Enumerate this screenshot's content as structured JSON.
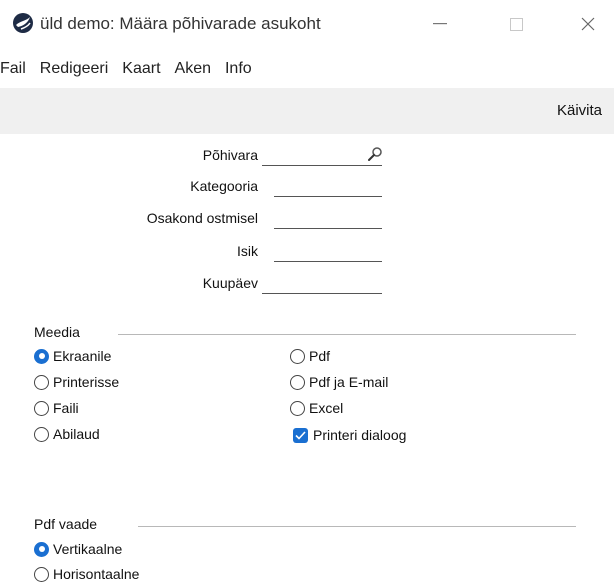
{
  "window": {
    "title": "üld demo: Määra põhivarade asukoht",
    "app_icon": "app-logo-icon",
    "controls": [
      "minimize-icon",
      "maximize-icon",
      "close-icon"
    ]
  },
  "menu": {
    "items": [
      "Fail",
      "Redigeeri",
      "Kaart",
      "Aken",
      "Info"
    ]
  },
  "toolbar": {
    "run_label": "Käivita"
  },
  "form": {
    "fields": [
      {
        "label": "Põhivara",
        "value": "",
        "has_search": true
      },
      {
        "label": "Kategooria",
        "value": ""
      },
      {
        "label": "Osakond ostmisel",
        "value": ""
      },
      {
        "label": "Isik",
        "value": ""
      },
      {
        "label": "Kuupäev",
        "value": ""
      }
    ]
  },
  "media": {
    "label": "Meedia",
    "options": [
      {
        "label": "Ekraanile",
        "selected": true
      },
      {
        "label": "Printerisse",
        "selected": false
      },
      {
        "label": "Faili",
        "selected": false
      },
      {
        "label": "Abilaud",
        "selected": false
      },
      {
        "label": "Pdf",
        "selected": false
      },
      {
        "label": "Pdf ja E-mail",
        "selected": false
      },
      {
        "label": "Excel",
        "selected": false
      }
    ],
    "printer_dialog": {
      "label": "Printeri dialoog",
      "checked": true
    }
  },
  "pdf_view": {
    "label": "Pdf vaade",
    "options": [
      {
        "label": "Vertikaalne",
        "selected": true
      },
      {
        "label": "Horisontaalne",
        "selected": false
      }
    ]
  },
  "colors": {
    "accent": "#1a6fd1",
    "toolbar_bg": "#f0f0f0"
  }
}
